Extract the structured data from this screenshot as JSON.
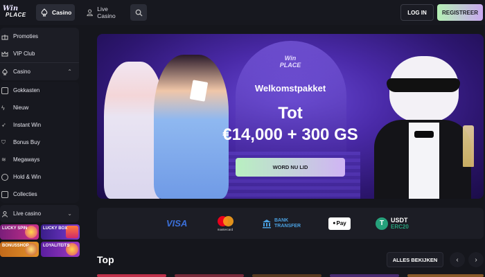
{
  "header": {
    "logo": {
      "line1": "Win",
      "line2": "PLACE"
    },
    "tabs": [
      {
        "label": "Casino"
      },
      {
        "label": "Live Casino"
      }
    ],
    "login_label": "LOG IN",
    "register_label": "REGISTREER"
  },
  "sidebar": {
    "top_items": [
      {
        "label": "Promoties"
      },
      {
        "label": "VIP Club"
      }
    ],
    "casino": {
      "label": "Casino",
      "items": [
        {
          "label": "Gokkasten"
        },
        {
          "label": "Nieuw"
        },
        {
          "label": "Instant Win"
        },
        {
          "label": "Bonus Buy"
        },
        {
          "label": "Megaways"
        },
        {
          "label": "Hold & Win"
        },
        {
          "label": "Collecties"
        }
      ]
    },
    "live_casino": {
      "label": "Live casino",
      "tiles": [
        {
          "label": "LUCKY SPIN"
        },
        {
          "label": "LUCKY BOX"
        },
        {
          "label": "BONUSSHOP"
        },
        {
          "label": "LOYALITEITS"
        }
      ]
    }
  },
  "banner": {
    "logo": {
      "line1": "Win",
      "line2": "PLACE"
    },
    "subtitle": "Welkomstpakket",
    "line1": "Tot",
    "amount": "€14,000 + 300 GS",
    "cta_label": "WORD NU LID"
  },
  "payments": {
    "visa": "VISA",
    "mastercard": "mastercard",
    "bank_line1": "BANK",
    "bank_line2": "TRANSFER",
    "applepay": "Pay",
    "usdt_line1": "USDT",
    "usdt_line2": "ERC20"
  },
  "section": {
    "title": "Top",
    "see_all_label": "ALLES BEKIJKEN"
  },
  "colors": {
    "background": "#15161c",
    "panel": "#1c1d25",
    "banner_purple": "#4a2aa8",
    "cta_gradient_start": "#b8f0c0",
    "cta_gradient_end": "#d0b4f4"
  }
}
